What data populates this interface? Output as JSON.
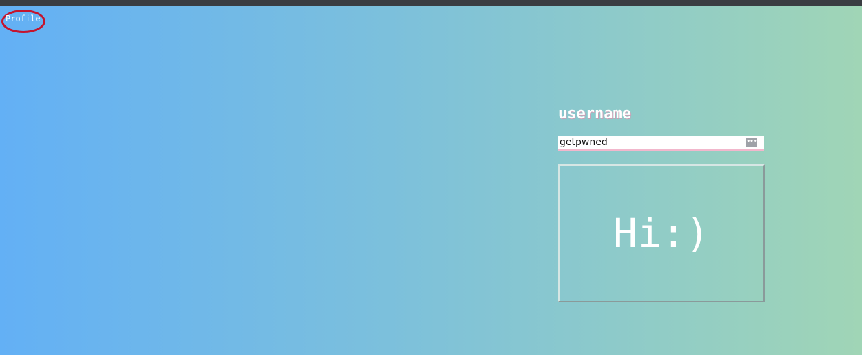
{
  "nav": {
    "profile_label": "Profile"
  },
  "form": {
    "username_label": "username",
    "username_value": "getpwned",
    "options_icon": "more-dots-icon"
  },
  "greeting": {
    "text": "Hi:)"
  },
  "colors": {
    "gradient_left": "#63b0f5",
    "gradient_right": "#a0d5b6",
    "highlight_circle": "#c4142e",
    "input_underline": "#f2b7cc"
  }
}
